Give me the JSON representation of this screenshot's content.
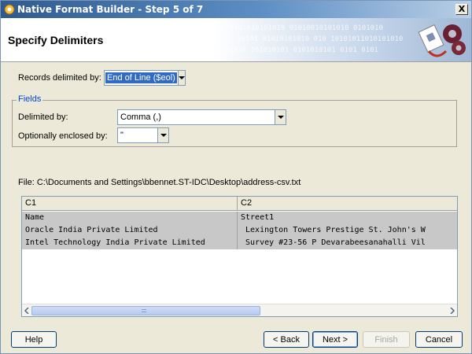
{
  "window": {
    "title": "Native Format Builder - Step 5 of 7",
    "close_glyph": "X"
  },
  "header": {
    "title": "Specify Delimiters",
    "binary_line1": "010101010101010 01010010101010 0101010",
    "binary_line2": "10101 01010101010 010 10101011010101010",
    "binary_line3": "0101010 101010101 0101010101 0101 0101"
  },
  "records": {
    "label": "Records delimited by:",
    "value": "End of Line ($eol)"
  },
  "fields": {
    "legend": "Fields",
    "delimited_label": "Delimited by:",
    "delimited_value": "Comma (,)",
    "enclosed_label": "Optionally enclosed by:",
    "enclosed_value": "\""
  },
  "file": {
    "path": "File: C:\\Documents and Settings\\bbennet.ST-IDC\\Desktop\\address-csv.txt"
  },
  "preview": {
    "columns": [
      "C1",
      "C2"
    ],
    "rows": [
      [
        "Name",
        "Street1"
      ],
      [
        "Oracle India Private Limited",
        " Lexington Towers Prestige St. John's W"
      ],
      [
        "Intel Technology India Private Limited",
        " Survey #23-56 P Devarabeesanahalli Vil"
      ]
    ],
    "scroll_fraction": 0.55
  },
  "buttons": {
    "help": "Help",
    "back": "< Back",
    "next": "Next >",
    "finish": "Finish",
    "cancel": "Cancel"
  },
  "colors": {
    "accent": "#316ac5",
    "legend": "#0046d5",
    "title_bar": "#2f5a8f"
  }
}
